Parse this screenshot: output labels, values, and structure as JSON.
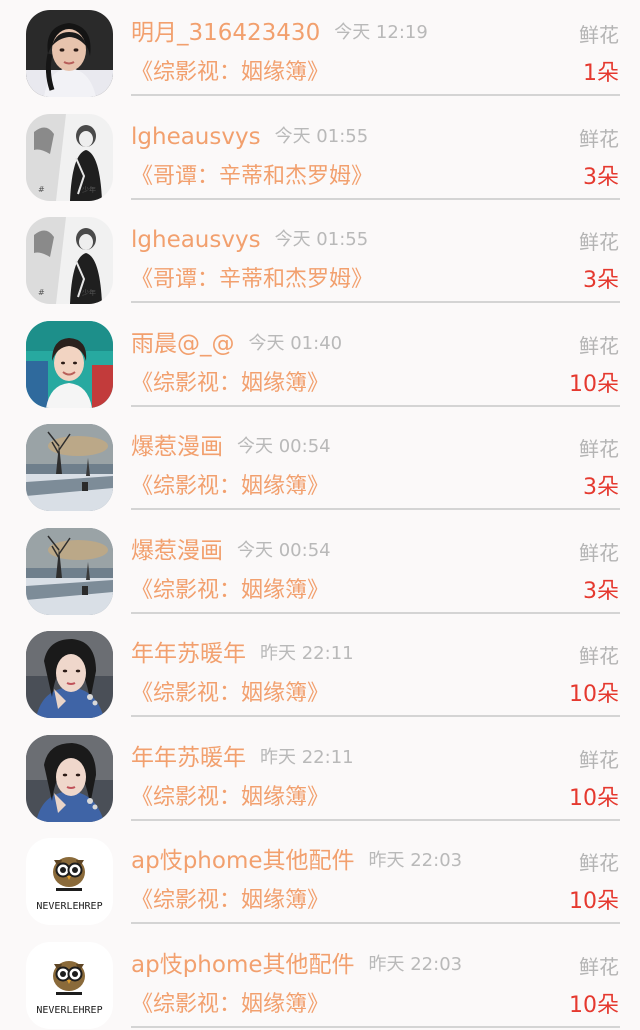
{
  "items": [
    {
      "name": "明月_316423430",
      "time": "今天 12:19",
      "gift": "鲜花",
      "work": "《综影视：姻缘簿》",
      "count": "1朵",
      "avatar": "woman-portrait"
    },
    {
      "name": "lgheausvys",
      "time": "今天 01:55",
      "gift": "鲜花",
      "work": "《哥谭：辛蒂和杰罗姆》",
      "count": "3朵",
      "avatar": "mono-sketch"
    },
    {
      "name": "lgheausvys",
      "time": "今天 01:55",
      "gift": "鲜花",
      "work": "《哥谭：辛蒂和杰罗姆》",
      "count": "3朵",
      "avatar": "mono-sketch"
    },
    {
      "name": "雨晨@_@",
      "time": "今天 01:40",
      "gift": "鲜花",
      "work": "《综影视：姻缘簿》",
      "count": "10朵",
      "avatar": "young-man"
    },
    {
      "name": "爆惹漫画",
      "time": "今天 00:54",
      "gift": "鲜花",
      "work": "《综影视：姻缘簿》",
      "count": "3朵",
      "avatar": "winter-landscape"
    },
    {
      "name": "爆惹漫画",
      "time": "今天 00:54",
      "gift": "鲜花",
      "work": "《综影视：姻缘簿》",
      "count": "3朵",
      "avatar": "winter-landscape"
    },
    {
      "name": "年年苏暖年",
      "time": "昨天 22:11",
      "gift": "鲜花",
      "work": "《综影视：姻缘簿》",
      "count": "10朵",
      "avatar": "costume-woman"
    },
    {
      "name": "年年苏暖年",
      "time": "昨天 22:11",
      "gift": "鲜花",
      "work": "《综影视：姻缘簿》",
      "count": "10朵",
      "avatar": "costume-woman"
    },
    {
      "name": "ap忮phome其他配件",
      "time": "昨天 22:03",
      "gift": "鲜花",
      "work": "《综影视：姻缘簿》",
      "count": "10朵",
      "avatar": "owl-logo",
      "logo_text": "NEVERLEHREP"
    },
    {
      "name": "ap忮phome其他配件",
      "time": "昨天 22:03",
      "gift": "鲜花",
      "work": "《综影视：姻缘簿》",
      "count": "10朵",
      "avatar": "owl-logo",
      "logo_text": "NEVERLEHREP"
    }
  ],
  "colors": {
    "name": "#f2a06e",
    "time": "#b9b9b9",
    "gift": "#b4b4b4",
    "count": "#e5392f",
    "divider": "#d4d4d4",
    "background": "#fbf9f9"
  }
}
